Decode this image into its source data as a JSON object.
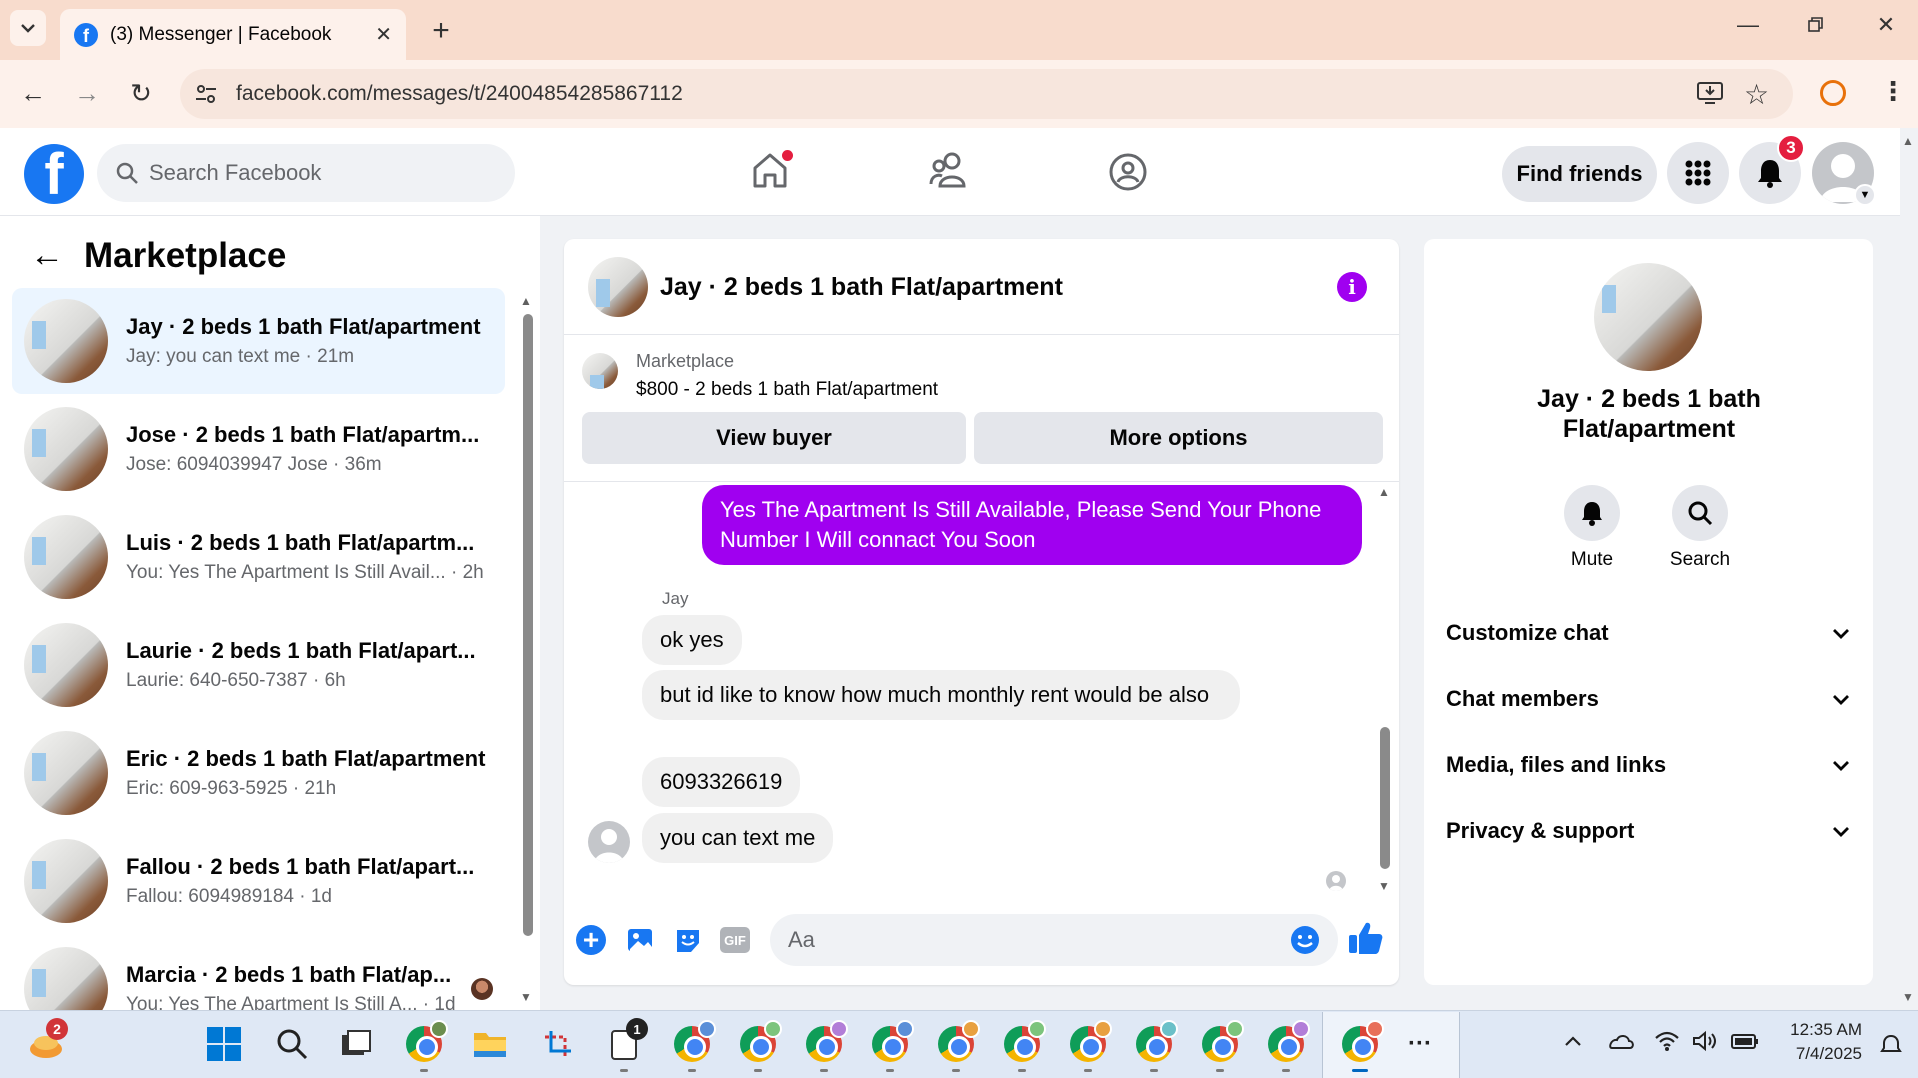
{
  "browser": {
    "tab_title": "(3) Messenger | Facebook",
    "url": "facebook.com/messages/t/24004854285867112"
  },
  "fb_header": {
    "search_placeholder": "Search Facebook",
    "find_friends": "Find friends",
    "notification_count": "3"
  },
  "left_panel": {
    "title": "Marketplace",
    "conversations": [
      {
        "name": "Jay · 2 beds 1 bath Flat/apartment",
        "preview": "Jay: you can text me · 21m",
        "active": true
      },
      {
        "name": "Jose · 2 beds 1 bath Flat/apartm...",
        "preview": "Jose: 6094039947 Jose · 36m"
      },
      {
        "name": "Luis · 2 beds 1 bath Flat/apartm...",
        "preview": "You: Yes The Apartment Is Still Avail... · 2h"
      },
      {
        "name": "Laurie · 2 beds 1 bath Flat/apart...",
        "preview": "Laurie: 640-650-7387 · 6h"
      },
      {
        "name": "Eric · 2 beds 1 bath Flat/apartment",
        "preview": "Eric: 609-963-5925 · 21h"
      },
      {
        "name": "Fallou · 2 beds 1 bath Flat/apart...",
        "preview": "Fallou: 6094989184 · 1d"
      },
      {
        "name": "Marcia · 2 beds 1 bath Flat/ap...",
        "preview": "You: Yes The Apartment Is Still A... · 1d"
      }
    ]
  },
  "chat": {
    "title": "Jay · 2 beds 1 bath Flat/apartment",
    "listing_source": "Marketplace",
    "listing": "$800 - 2 beds 1 bath Flat/apartment",
    "view_buyer": "View buyer",
    "more_options": "More options",
    "outgoing_message": "Yes The Apartment Is Still Available, Please Send Your Phone Number I Will connact You Soon",
    "sender_name": "Jay",
    "messages": [
      "ok yes",
      "but id like to know how much monthly rent would be also",
      "6093326619",
      "you can text me"
    ],
    "composer_placeholder": "Aa",
    "gif_label": "GIF"
  },
  "right_panel": {
    "name": "Jay · 2 beds 1 bath Flat/apartment",
    "mute": "Mute",
    "search": "Search",
    "sections": [
      "Customize chat",
      "Chat members",
      "Media, files and links",
      "Privacy & support"
    ]
  },
  "taskbar": {
    "time": "12:35 AM",
    "date": "7/4/2025",
    "widget_badge": "2",
    "notepad_badge": "1"
  },
  "colors": {
    "fb_blue": "#1877f2",
    "message_purple": "#a000f0",
    "active_conversation": "#ebf5ff",
    "tab_strip": "#f8dccd"
  }
}
